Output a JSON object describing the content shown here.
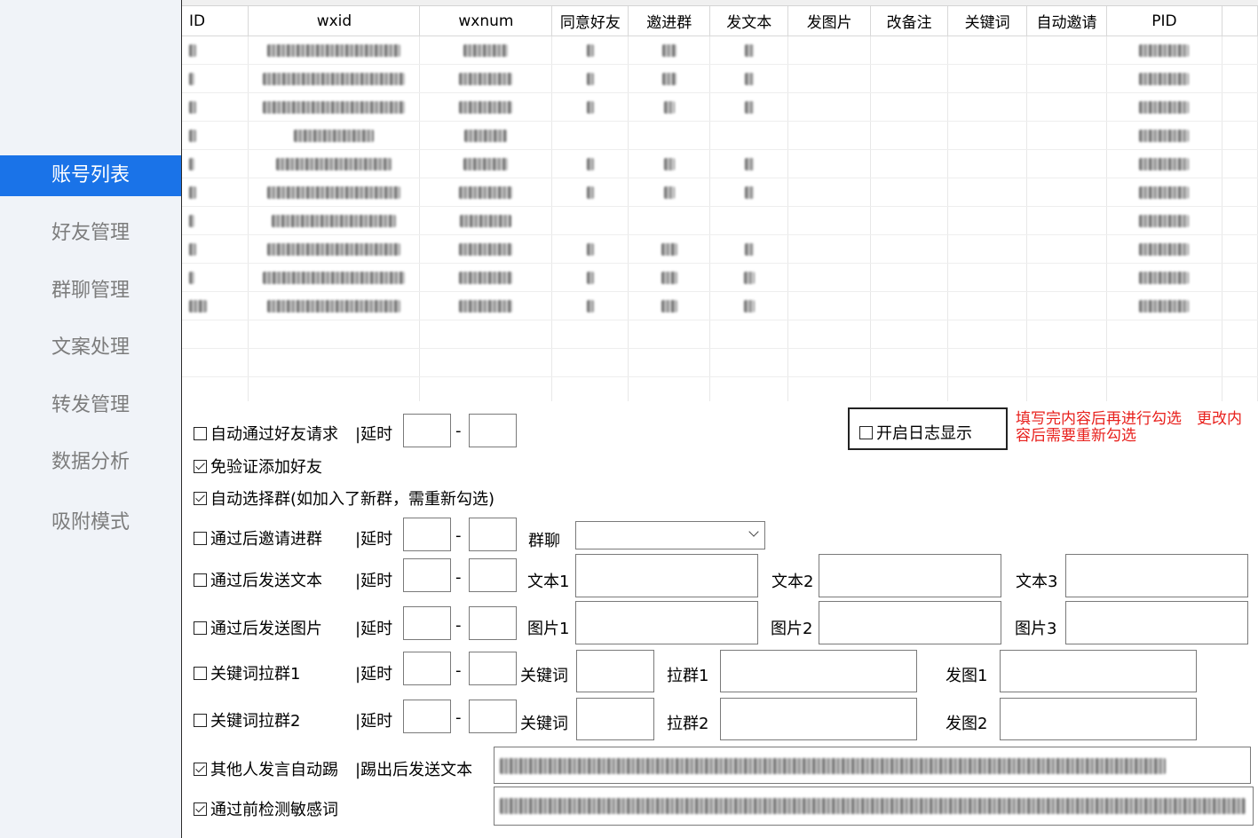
{
  "sidebar": {
    "items": [
      {
        "label": "账号列表",
        "active": true
      },
      {
        "label": "好友管理"
      },
      {
        "label": "群聊管理"
      },
      {
        "label": "文案处理"
      },
      {
        "label": "转发管理"
      },
      {
        "label": "数据分析"
      },
      {
        "label": "吸附模式"
      }
    ],
    "active_color": "#1a73e8"
  },
  "table": {
    "columns": [
      "ID",
      "wxid",
      "wxnum",
      "同意好友",
      "邀进群",
      "发文本",
      "发图片",
      "改备注",
      "关键词",
      "自动邀请",
      "PID"
    ],
    "rows_note": "account rows blurred in screenshot"
  },
  "settings": {
    "auto_accept": {
      "label": "自动通过好友请求",
      "checked": false
    },
    "delay_label": "|延时",
    "no_verify_add": {
      "label": "免验证添加好友",
      "checked": true
    },
    "auto_select_group": {
      "label": "自动选择群(如加入了新群，需重新勾选)",
      "checked": true
    },
    "invite_after_accept": {
      "label": "通过后邀请进群",
      "checked": false
    },
    "group_chat_label": "群聊",
    "group_chat_value": "",
    "send_text_after": {
      "label": "通过后发送文本",
      "checked": false
    },
    "text1_label": "文本1",
    "text2_label": "文本2",
    "text3_label": "文本3",
    "send_image_after": {
      "label": "通过后发送图片",
      "checked": false
    },
    "image1_label": "图片1",
    "image2_label": "图片2",
    "image3_label": "图片3",
    "keyword_pull1": {
      "label": "关键词拉群1",
      "checked": false
    },
    "keyword_pull2": {
      "label": "关键词拉群2",
      "checked": false
    },
    "keyword_label": "关键词",
    "pull_group1_label": "拉群1",
    "pull_group2_label": "拉群2",
    "send_image1_label": "发图1",
    "send_image2_label": "发图2",
    "auto_kick": {
      "label": "其他人发言自动踢",
      "checked": true
    },
    "kick_send_text_label": "|踢出后发送文本",
    "sensitive_check": {
      "label": "通过前检测敏感词",
      "checked": true
    },
    "enable_log": {
      "label": "开启日志显示",
      "checked": false
    },
    "notice": "填写完内容后再进行勾选　更改内容后需要重新勾选",
    "notice_color": "#e8201c"
  }
}
